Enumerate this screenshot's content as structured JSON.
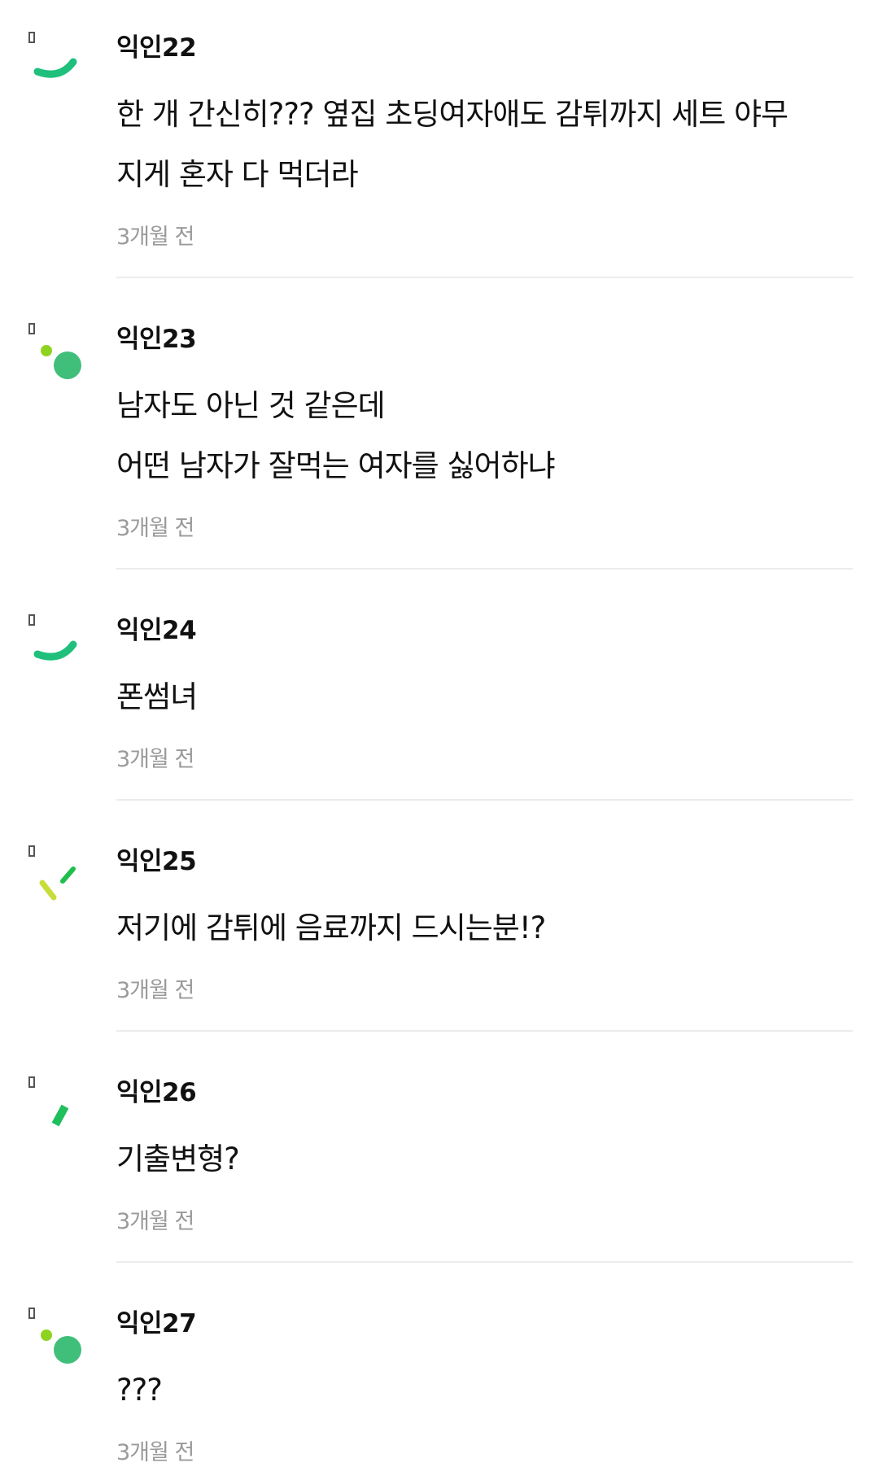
{
  "comments": [
    {
      "author": "익인22",
      "lines": [
        "한 개 간신히??? 옆집 초딩여자애도 감튀까지 세트 야무",
        "지게 혼자 다 먹더라"
      ],
      "time": "3개월 전",
      "avatar_icon": "green-arc-icon"
    },
    {
      "author": "익인23",
      "lines": [
        "남자도 아닌 것 같은데",
        "어떤 남자가 잘먹는 여자를 싫어하냐"
      ],
      "time": "3개월 전",
      "avatar_icon": "green-dots-icon"
    },
    {
      "author": "익인24",
      "lines": [
        "폰썸녀"
      ],
      "time": "3개월 전",
      "avatar_icon": "green-arc-icon"
    },
    {
      "author": "익인25",
      "lines": [
        "저기에 감튀에 음료까지 드시는분!?"
      ],
      "time": "3개월 전",
      "avatar_icon": "lime-slash-icon"
    },
    {
      "author": "익인26",
      "lines": [
        "기출변형?"
      ],
      "time": "3개월 전",
      "avatar_icon": "green-bar-icon"
    },
    {
      "author": "익인27",
      "lines": [
        "???"
      ],
      "time": "3개월 전",
      "avatar_icon": "green-dots-icon"
    }
  ],
  "colors": {
    "accent_green": "#1fbf7c",
    "accent_lime": "#8ed31f",
    "accent_yellow": "#c8dc3a",
    "timestamp": "#9a9a9a",
    "divider": "#ececec"
  }
}
